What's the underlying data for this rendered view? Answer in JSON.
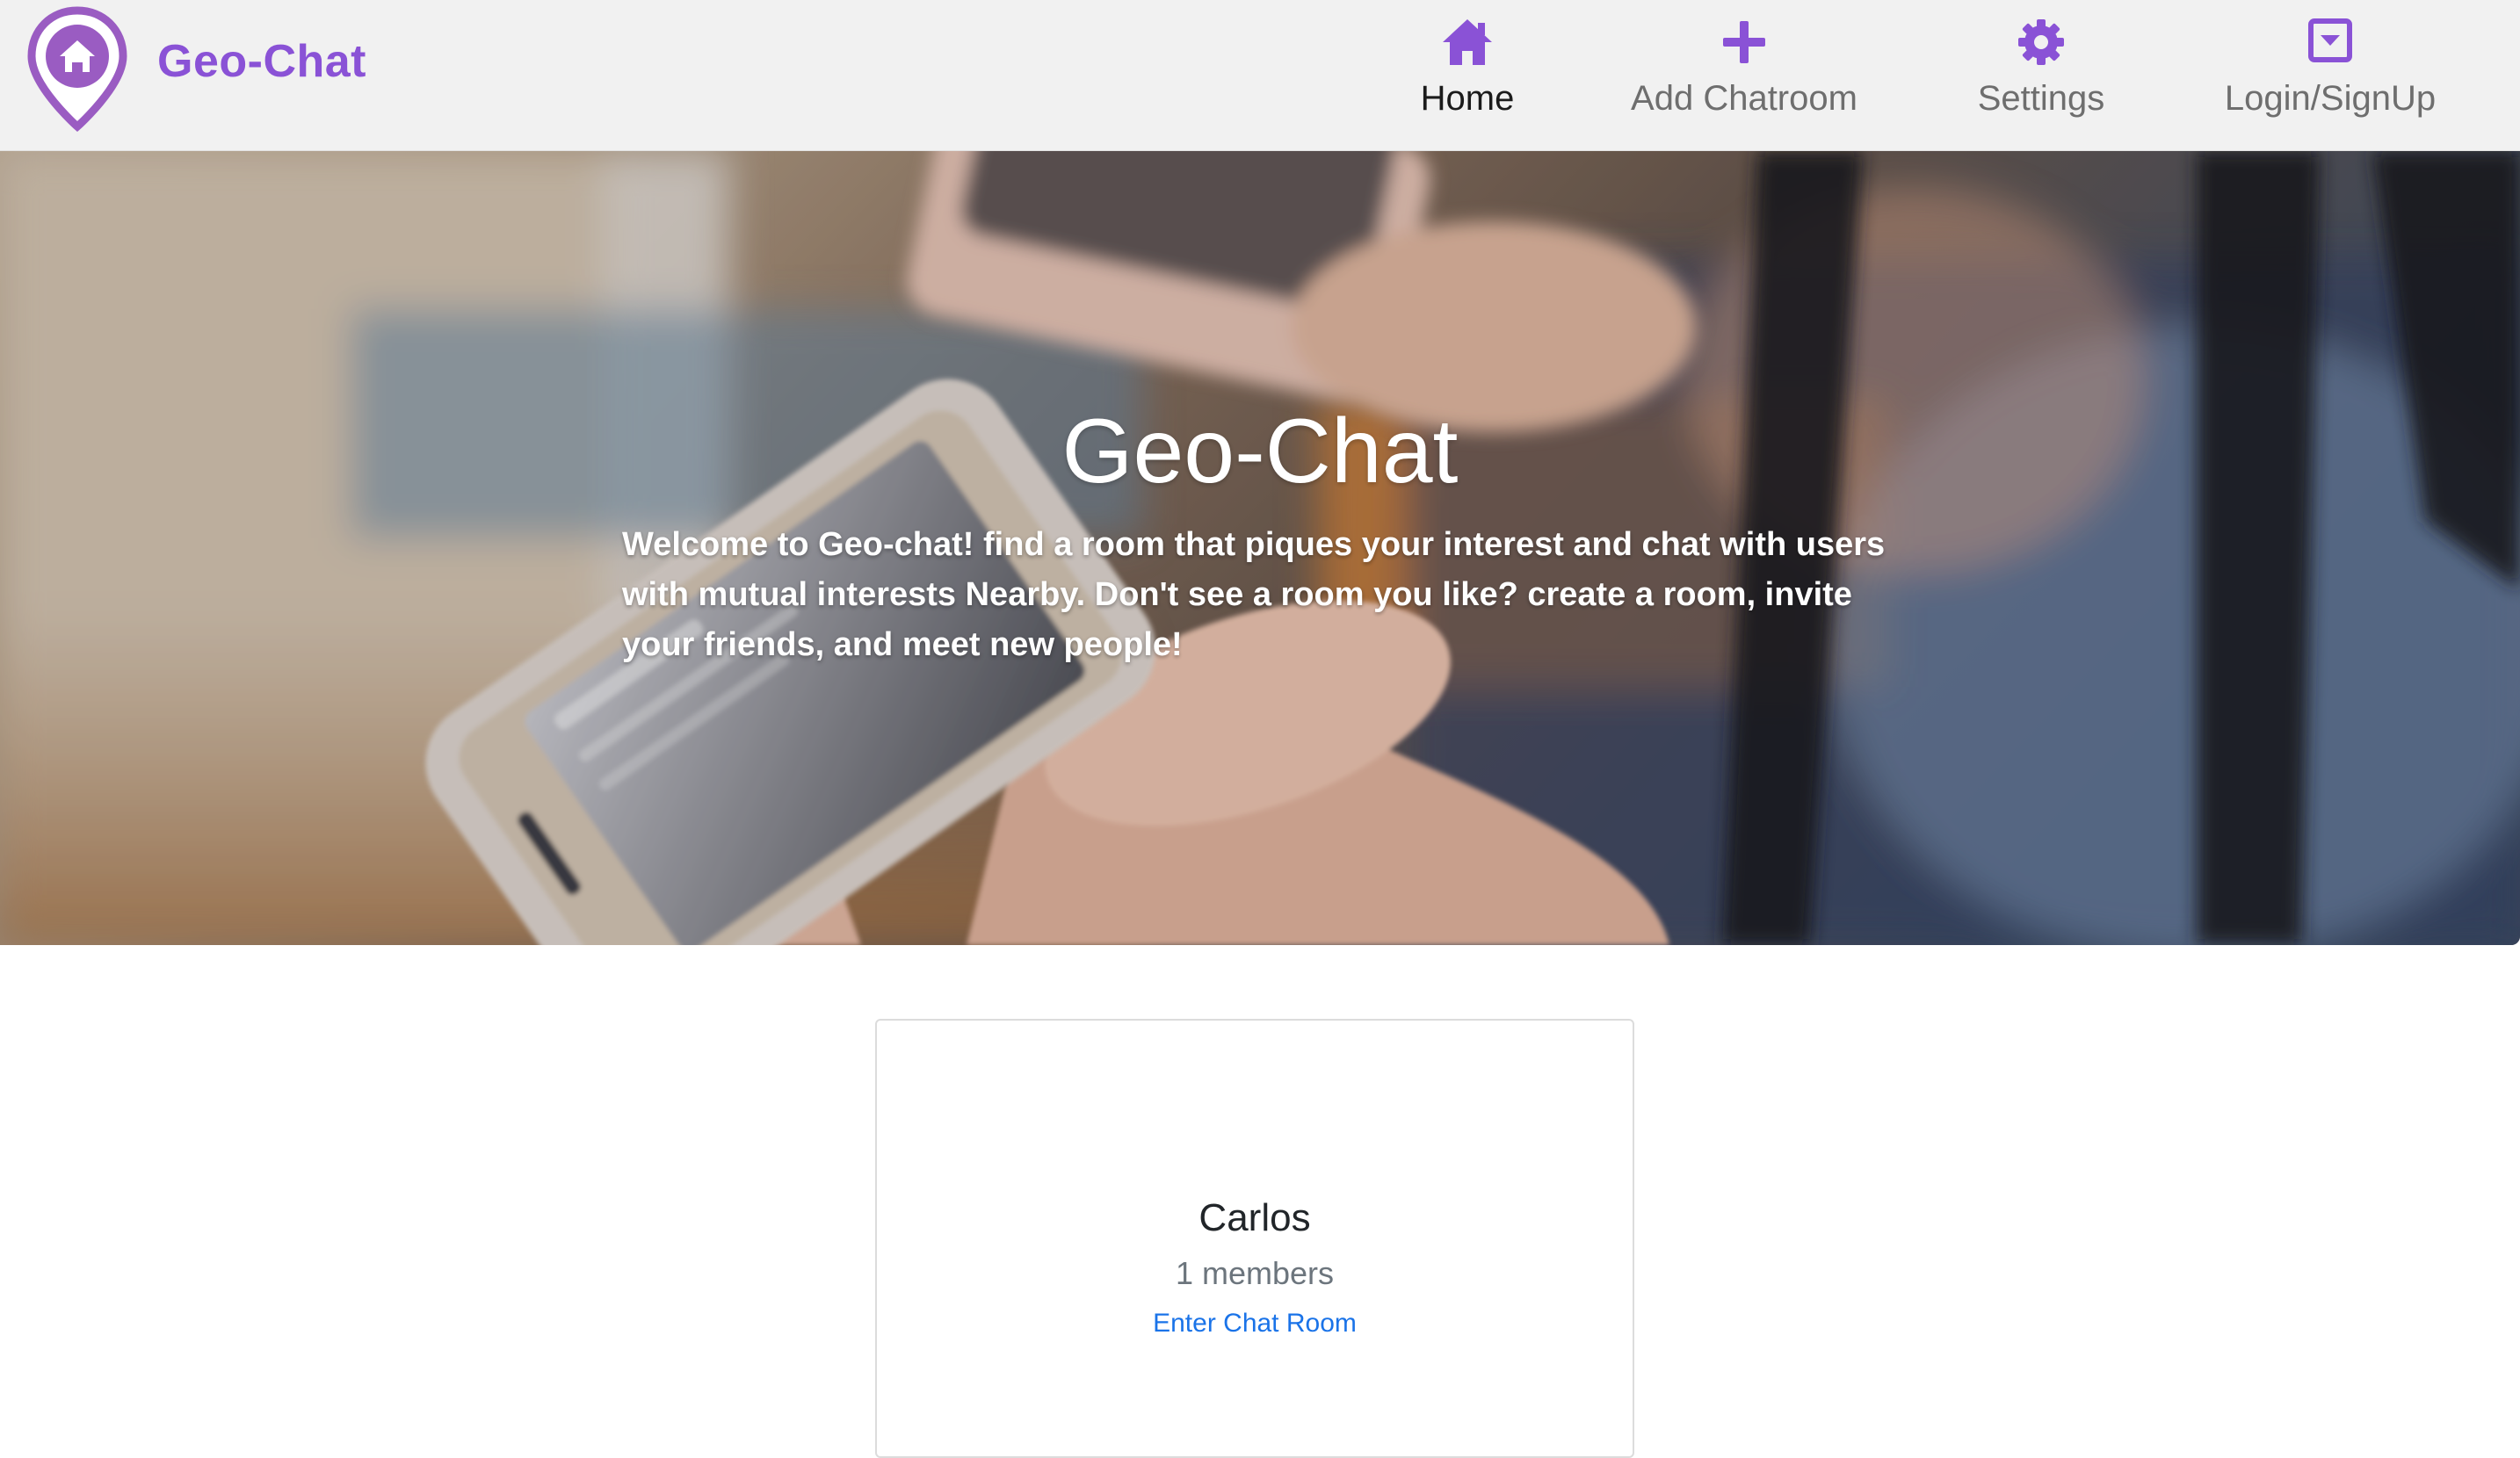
{
  "brand": {
    "name": "Geo-Chat",
    "logo_icon": "map-pin-home-icon",
    "color": "#8a52d6"
  },
  "nav": {
    "items": [
      {
        "label": "Home",
        "icon": "home-icon",
        "active": true
      },
      {
        "label": "Add Chatroom",
        "icon": "plus-icon",
        "active": false
      },
      {
        "label": "Settings",
        "icon": "gear-icon",
        "active": false
      },
      {
        "label": "Login/SignUp",
        "icon": "dropdown-box-icon",
        "active": false
      }
    ],
    "icon_color": "#8a52d6",
    "background": "#f1f1f1"
  },
  "hero": {
    "title": "Geo-Chat",
    "text": "Welcome to Geo-chat! find a room that piques your interest and chat with users with mutual interests Nearby. Don't see a room you like? create a room, invite your friends, and meet new people!",
    "image": "blurred-photo-of-hands-holding-smartphones"
  },
  "rooms": [
    {
      "name": "Carlos",
      "members": "1 members",
      "link_label": "Enter Chat Room"
    }
  ],
  "colors": {
    "link": "#1a73e8",
    "muted_text": "#6c757d",
    "hero_text": "#ffffff"
  }
}
